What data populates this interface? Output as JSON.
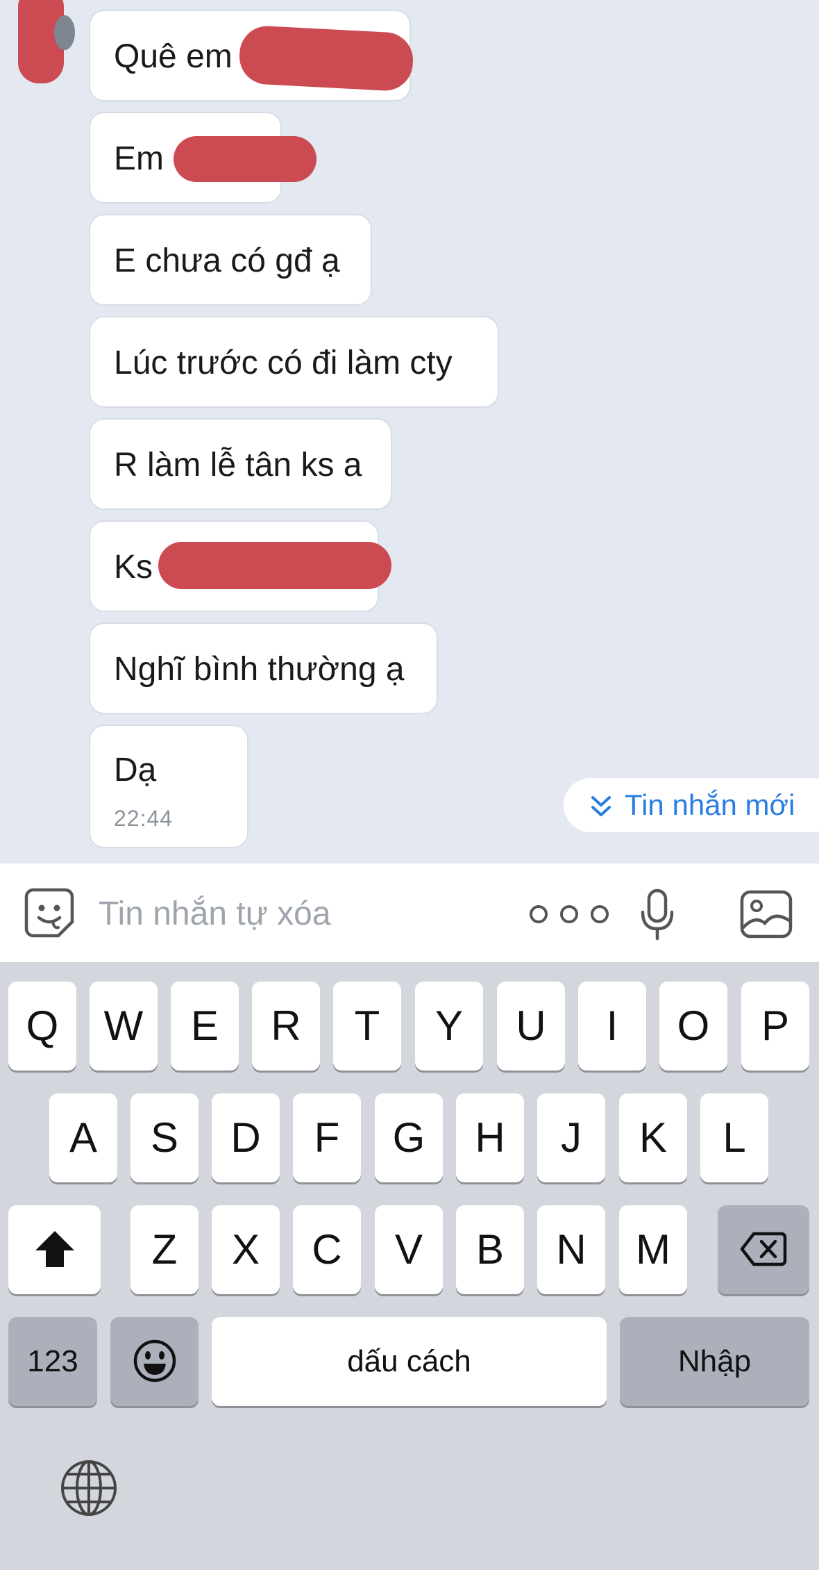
{
  "messages": [
    {
      "text": "Quê em ",
      "time": ""
    },
    {
      "text": "Em ",
      "time": ""
    },
    {
      "text": "E chưa có gđ ạ",
      "time": ""
    },
    {
      "text": "Lúc trước có đi làm cty",
      "time": ""
    },
    {
      "text": "R làm lễ tân ks a",
      "time": ""
    },
    {
      "text": "Ks ",
      "time": ""
    },
    {
      "text": "Nghĩ bình thường ạ",
      "time": ""
    },
    {
      "text": "Dạ",
      "time": "22:44"
    }
  ],
  "new_message_label": "Tin nhắn mới",
  "input": {
    "placeholder": "Tin nhắn tự xóa",
    "value": ""
  },
  "keyboard": {
    "row1": [
      "Q",
      "W",
      "E",
      "R",
      "T",
      "Y",
      "U",
      "I",
      "O",
      "P"
    ],
    "row2": [
      "A",
      "S",
      "D",
      "F",
      "G",
      "H",
      "J",
      "K",
      "L"
    ],
    "row3": [
      "Z",
      "X",
      "C",
      "V",
      "B",
      "N",
      "M"
    ],
    "numbers_label": "123",
    "space_label": "dấu cách",
    "return_label": "Nhập"
  },
  "colors": {
    "accent": "#2a7de1",
    "redaction": "#cc4a52",
    "chat_bg": "#e3e8f1",
    "keyboard_bg": "#d3d6dc"
  },
  "icons": [
    "emoji-sticker-icon",
    "more-options-icon",
    "microphone-icon",
    "image-gallery-icon",
    "double-chevron-down-icon",
    "shift-icon",
    "backspace-icon",
    "emoji-icon",
    "globe-icon"
  ]
}
